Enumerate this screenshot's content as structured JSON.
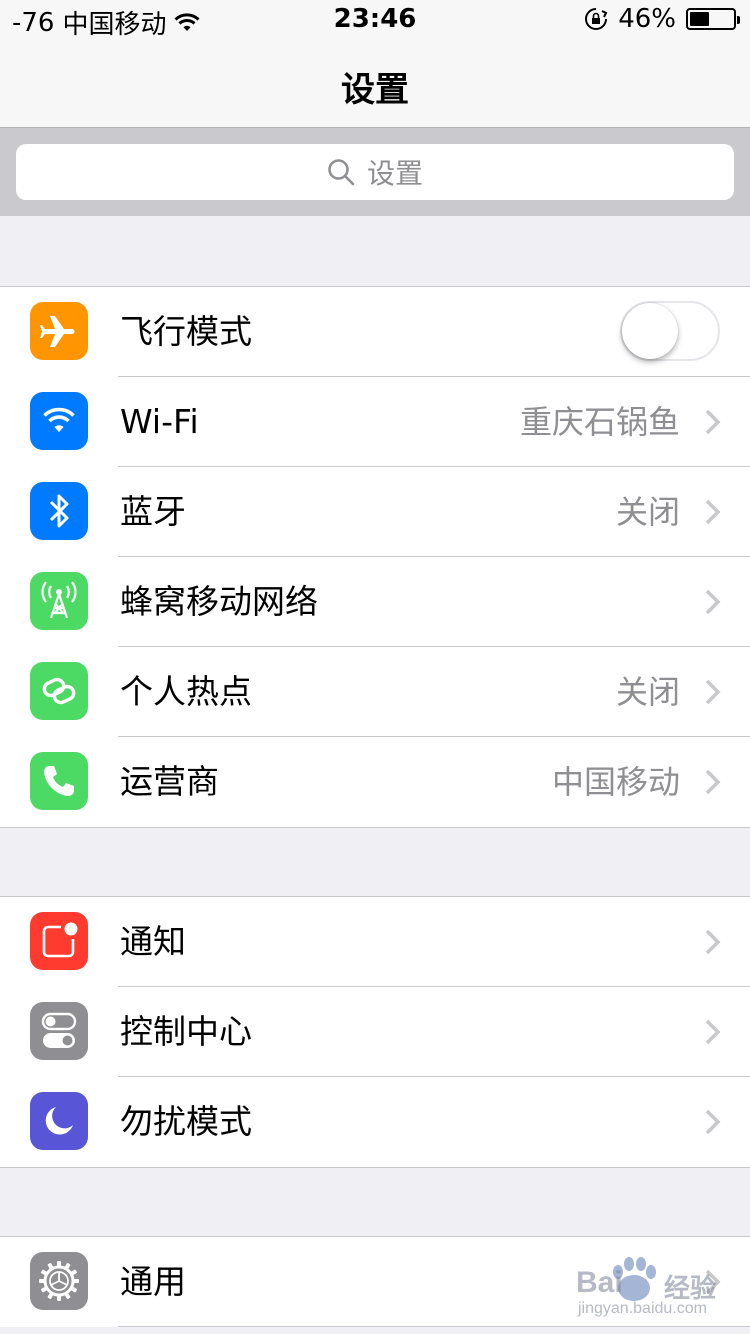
{
  "status_bar": {
    "signal": "-76",
    "carrier": "中国移动",
    "time": "23:46",
    "battery_percent": "46%",
    "battery_level": 0.46,
    "icons": [
      "wifi-icon",
      "rotation-lock-icon",
      "battery-icon"
    ]
  },
  "nav": {
    "title": "设置"
  },
  "search": {
    "placeholder": "设置"
  },
  "groups": [
    {
      "rows": [
        {
          "label": "飞行模式",
          "icon": "airplane-icon",
          "color": "#ff9500",
          "toggle": false
        },
        {
          "label": "Wi-Fi",
          "value": "重庆石锅鱼",
          "icon": "wifi-icon",
          "color": "#007aff"
        },
        {
          "label": "蓝牙",
          "value": "关闭",
          "icon": "bluetooth-icon",
          "color": "#007aff"
        },
        {
          "label": "蜂窝移动网络",
          "icon": "cellular-antenna-icon",
          "color": "#4cd964"
        },
        {
          "label": "个人热点",
          "value": "关闭",
          "icon": "hotspot-icon",
          "color": "#4cd964"
        },
        {
          "label": "运营商",
          "value": "中国移动",
          "icon": "phone-icon",
          "color": "#4cd964"
        }
      ]
    },
    {
      "rows": [
        {
          "label": "通知",
          "icon": "notifications-icon",
          "color": "#ff3b30"
        },
        {
          "label": "控制中心",
          "icon": "control-center-icon",
          "color": "#8e8e93"
        },
        {
          "label": "勿扰模式",
          "icon": "moon-icon",
          "color": "#5856d6"
        }
      ]
    },
    {
      "rows": [
        {
          "label": "通用",
          "icon": "gear-icon",
          "color": "#8e8e93"
        }
      ]
    }
  ],
  "watermark": {
    "brand": "Bai",
    "brand_cn": "经验",
    "url": "jingyan.baidu.com"
  }
}
